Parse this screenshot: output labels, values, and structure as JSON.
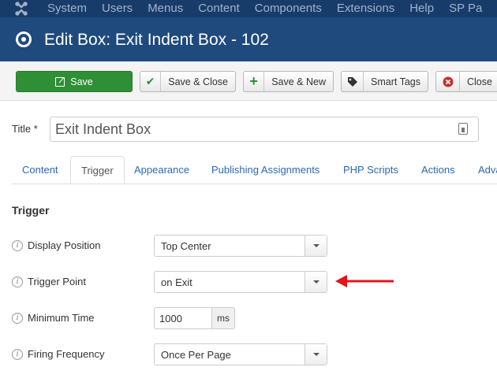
{
  "navbar": {
    "items": [
      "System",
      "Users",
      "Menus",
      "Content",
      "Components",
      "Extensions",
      "Help",
      "SP Pa"
    ]
  },
  "header": {
    "title": "Edit Box: Exit Indent Box - 102"
  },
  "toolbar": {
    "save": "Save",
    "save_close": "Save & Close",
    "save_new": "Save & New",
    "smart_tags": "Smart Tags",
    "close": "Close"
  },
  "title_field": {
    "label": "Title *",
    "value": "Exit Indent Box"
  },
  "tabs": [
    "Content",
    "Trigger",
    "Appearance",
    "Publishing Assignments",
    "PHP Scripts",
    "Actions",
    "Adva"
  ],
  "active_tab": "Trigger",
  "section": {
    "title": "Trigger"
  },
  "fields": {
    "display_position": {
      "label": "Display Position",
      "value": "Top Center"
    },
    "trigger_point": {
      "label": "Trigger Point",
      "value": "on Exit"
    },
    "minimum_time": {
      "label": "Minimum Time",
      "value": "1000",
      "unit": "ms"
    },
    "firing_frequency": {
      "label": "Firing Frequency",
      "value": "Once Per Page"
    }
  },
  "colors": {
    "navbar": "#183c6a",
    "titlebar": "#1e4a7e",
    "save_button": "#2f8f36",
    "link": "#2a69b8",
    "annotation_arrow": "#e0161b"
  }
}
